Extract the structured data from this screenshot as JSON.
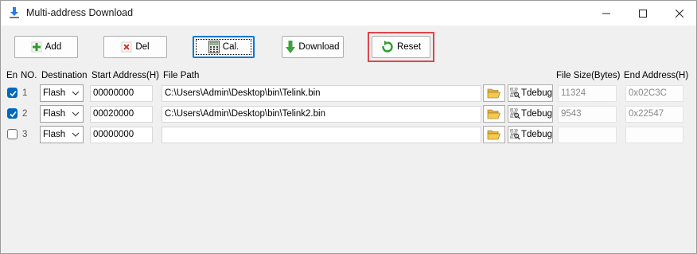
{
  "window": {
    "title": "Multi-address Download"
  },
  "toolbar": {
    "add_label": "Add",
    "del_label": "Del",
    "cal_label": "Cal.",
    "download_label": "Download",
    "reset_label": "Reset"
  },
  "headers": {
    "en": "En",
    "no": "NO.",
    "destination": "Destination",
    "start_address": "Start Address(H)",
    "file_path": "File Path",
    "file_size": "File Size(Bytes)",
    "end_address": "End Address(H)"
  },
  "rows": [
    {
      "enabled": true,
      "no": "1",
      "destination": "Flash",
      "start_address": "00000000",
      "file_path": "C:\\Users\\Admin\\Desktop\\bin\\Telink.bin",
      "tdebug_label": "Tdebug",
      "file_size": "11324",
      "end_address": "0x02C3C"
    },
    {
      "enabled": true,
      "no": "2",
      "destination": "Flash",
      "start_address": "00020000",
      "file_path": "C:\\Users\\Admin\\Desktop\\bin\\Telink2.bin",
      "tdebug_label": "Tdebug",
      "file_size": "9543",
      "end_address": "0x22547"
    },
    {
      "enabled": false,
      "no": "3",
      "destination": "Flash",
      "start_address": "00000000",
      "file_path": "",
      "tdebug_label": "Tdebug",
      "file_size": "",
      "end_address": ""
    }
  ],
  "colors": {
    "accent": "#0067c0",
    "highlight": "#e0454b",
    "reset_icon": "#2e9e2e",
    "download_icon": "#3aa53a",
    "del_icon": "#d9341f"
  },
  "icons": [
    "download-app-icon",
    "minimize-icon",
    "maximize-icon",
    "close-icon",
    "plus-icon",
    "x-icon",
    "calculator-icon",
    "down-arrow-icon",
    "refresh-icon",
    "folder-open-icon",
    "binary-search-icon",
    "chevron-down-icon",
    "checkmark-icon"
  ]
}
